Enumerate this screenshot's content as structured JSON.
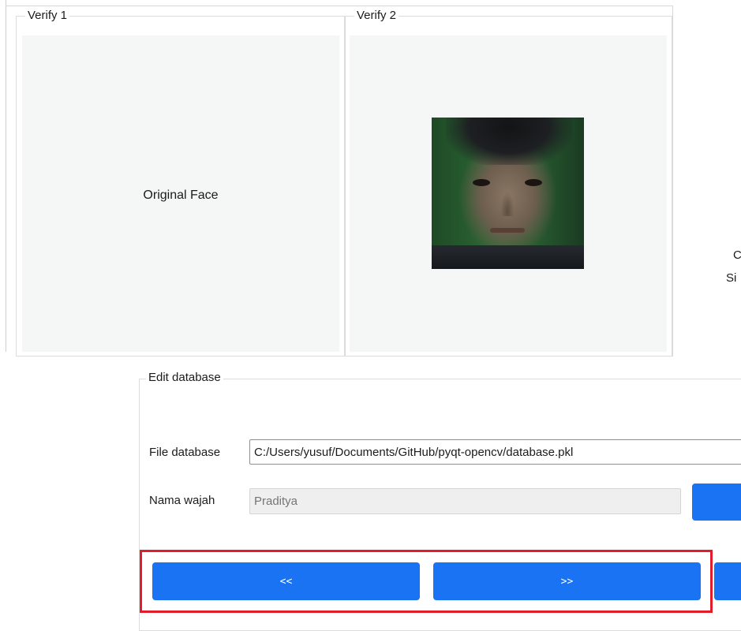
{
  "verify1": {
    "title": "Verify 1",
    "placeholder": "Original Face"
  },
  "verify2": {
    "title": "Verify 2",
    "image": "captured-face-photo"
  },
  "side": {
    "line1": "C",
    "line2": "Si"
  },
  "edit_database": {
    "title": "Edit database",
    "file_label": "File database",
    "file_value": "C:/Users/yusuf/Documents/GitHub/pyqt-opencv/database.pkl",
    "name_label": "Nama wajah",
    "name_placeholder": "Praditya",
    "prev_label": "<<",
    "next_label": ">>"
  },
  "colors": {
    "button": "#1a73f2",
    "highlight": "#e11d2b",
    "panel": "#f5f6f6"
  }
}
